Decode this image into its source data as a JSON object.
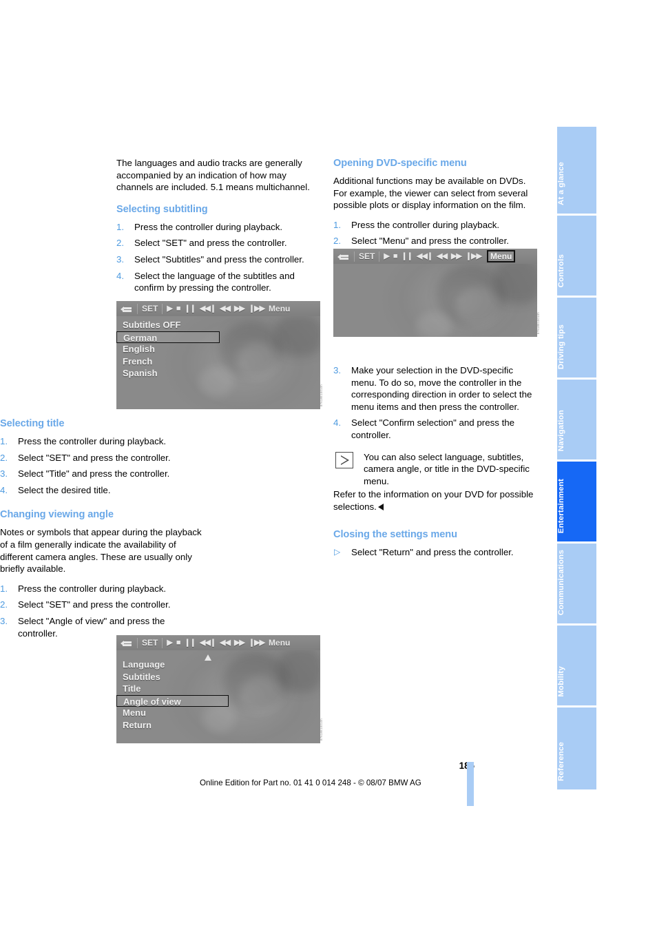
{
  "document": {
    "page_number": "185",
    "footer_note": "Online Edition for Part no. 01 41 0 014 248 - © 08/07 BMW AG"
  },
  "left_column": {
    "intro_paragraph": "The languages and audio tracks are generally accompanied by an indication of how may channels are included. 5.1 means multichannel.",
    "sections": [
      {
        "heading": "Selecting subtitling",
        "steps": [
          "Press the controller during playback.",
          "Select \"SET\" and press the controller.",
          "Select \"Subtitles\" and press the controller.",
          "Select the language of the subtitles and confirm by pressing the controller."
        ]
      },
      {
        "heading": "Selecting title",
        "steps": [
          "Press the controller during playback.",
          "Select \"SET\" and press the controller.",
          "Select \"Title\" and press the controller.",
          "Select the desired title."
        ]
      },
      {
        "heading": "Changing viewing angle",
        "paragraph": "Notes or symbols that appear during the playback of a film generally indicate the availability of different camera angles. These are usually only briefly available.",
        "steps": [
          "Press the controller during playback.",
          "Select \"SET\" and press the controller.",
          "Select \"Angle of view\" and press the controller."
        ]
      }
    ]
  },
  "right_column": {
    "sections": [
      {
        "heading": "Opening DVD-specific menu",
        "paragraph": "Additional functions may be available on DVDs. For example, the viewer can select from several possible plots or display information on the film.",
        "steps": [
          "Press the controller during playback.",
          "Select \"Menu\" and press the controller."
        ]
      }
    ],
    "steps_after_figure": [
      "Make your selection in the DVD-specific menu. To do so, move the controller in the corresponding direction in order to select the menu items and then press the controller.",
      "Select \"Confirm selection\" and press the controller."
    ],
    "note": {
      "icon": "note-triangle-icon",
      "text_line1": "You can also select language, subtitles, camera angle, or title in the DVD-specific menu.",
      "text_line2": "Refer to the information on your DVD for possible selections."
    },
    "closing_section": {
      "heading": "Closing the settings menu",
      "bullet": "Select \"Return\" and press the controller."
    }
  },
  "figures": {
    "subtitles_menu": {
      "caption_code": "87618E10010h",
      "control_bar": {
        "back_icon": "back-arrow-icon",
        "set_label": "SET",
        "play_icon": "▶",
        "stop_icon": "■",
        "pause_icon": "❙❙",
        "prev_track_icon": "◀◀❙",
        "rewind_icon": "◀◀",
        "forward_icon": "▶▶",
        "next_track_icon": "❙▶▶",
        "menu_label": "Menu"
      },
      "menu_items": [
        "Subtitles OFF",
        "German",
        "English",
        "French",
        "Spanish"
      ],
      "selected_item": "German"
    },
    "dvd_menu_highlight": {
      "caption_code": "87618E10010h",
      "control_bar": {
        "back_icon": "back-arrow-icon",
        "set_label": "SET",
        "play_icon": "▶",
        "stop_icon": "■",
        "pause_icon": "❙❙",
        "prev_track_icon": "◀◀❙",
        "rewind_icon": "◀◀",
        "forward_icon": "▶▶",
        "next_track_icon": "❙▶▶",
        "menu_label": "Menu"
      },
      "highlighted_control": "Menu"
    },
    "angle_of_view_menu": {
      "caption_code": "87618E10010h",
      "control_bar": {
        "back_icon": "back-arrow-icon",
        "set_label": "SET",
        "play_icon": "▶",
        "stop_icon": "■",
        "pause_icon": "❙❙",
        "prev_track_icon": "◀◀❙",
        "rewind_icon": "◀◀",
        "forward_icon": "▶▶",
        "next_track_icon": "❙▶▶",
        "menu_label": "Menu"
      },
      "menu_items": [
        "Language",
        "Subtitles",
        "Title",
        "Angle of view",
        "Menu",
        "Return"
      ],
      "selected_item": "Angle of view"
    }
  },
  "thumb_index": {
    "active": "Entertainment",
    "tabs": [
      {
        "label": "At a glance",
        "active": false
      },
      {
        "label": "Controls",
        "active": false
      },
      {
        "label": "Driving tips",
        "active": false
      },
      {
        "label": "Navigation",
        "active": false
      },
      {
        "label": "Entertainment",
        "active": true
      },
      {
        "label": "Communications",
        "active": false
      },
      {
        "label": "Mobility",
        "active": false
      },
      {
        "label": "Reference",
        "active": false
      }
    ]
  },
  "colors": {
    "heading_blue": "#6aa8e8",
    "accent_blue": "#4d9ae0",
    "tab_blue": "#a9ccf5",
    "tab_active_blue": "#1668f5"
  }
}
